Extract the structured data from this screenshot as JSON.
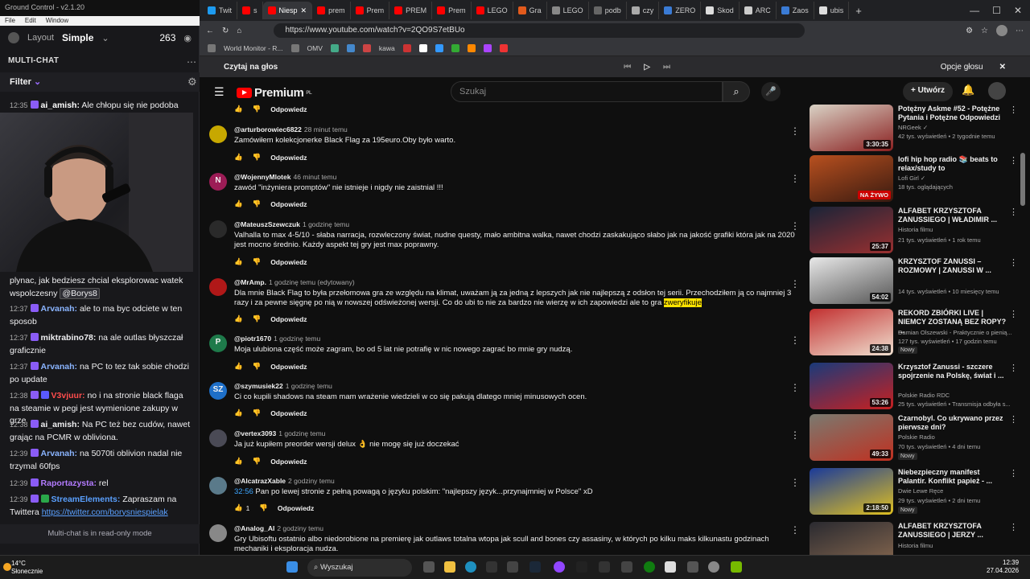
{
  "gc": {
    "title": "Ground Control - v2.1.20",
    "menu": [
      "File",
      "Edit",
      "Window"
    ],
    "layout_label": "Layout",
    "layout_value": "Simple",
    "viewers": "263",
    "panel_title": "MULTI-CHAT",
    "filter_label": "Filter",
    "readonly_text": "Multi-chat is in read-only mode",
    "messages": [
      {
        "time": "12:35",
        "user": "ai_amish:",
        "text": "Ale chłopu się nie podoba",
        "color": "#ffffff"
      },
      {
        "time": "",
        "user": "",
        "text": "plynac, jak bedziesz chcial eksplorowac watek wspolczesny",
        "mention": "@Borys8",
        "color": "#ffffff"
      },
      {
        "time": "12:37",
        "user": "Arvanah:",
        "text": "ale to ma byc odciete w ten sposob",
        "color": "#8ab4ff"
      },
      {
        "time": "12:37",
        "user": "miktrabino78:",
        "text": "na ale outlas błyszczał graficznie",
        "color": "#ffffff"
      },
      {
        "time": "12:37",
        "user": "Arvanah:",
        "text": "na PC to tez tak sobie chodzi po update",
        "color": "#8ab4ff"
      },
      {
        "time": "12:38",
        "user": "V3vjuur:",
        "text": "no i na stronie black flaga na steamie w pegi jest wymienione zakupy w grze",
        "color": "#ff4d4d"
      },
      {
        "time": "12:38",
        "user": "ai_amish:",
        "text": "Na PC też bez cudów, nawet grając na PCMR w obliviona.",
        "color": "#ffffff"
      },
      {
        "time": "12:39",
        "user": "Arvanah:",
        "text": "na 5070ti oblivion nadal nie trzymal 60fps",
        "color": "#8ab4ff"
      },
      {
        "time": "12:39",
        "user": "Raportazysta:",
        "text": "rel",
        "color": "#b37bff"
      },
      {
        "time": "12:39",
        "user": "StreamElements:",
        "text": "Zapraszam na Twittera",
        "link": "https://twitter.com/borysniespielak",
        "color": "#5aa0ff"
      }
    ]
  },
  "browser": {
    "tabs": [
      "Twit",
      "s",
      "Niesp",
      "prem",
      "Prem",
      "PREM",
      "Prem",
      "LEGO",
      "Gra",
      "LEGO",
      "podb",
      "czy",
      "ZERO",
      "Skod",
      "ARC",
      "Zaos",
      "ubis"
    ],
    "active_tab": 2,
    "url": "https://www.youtube.com/watch?v=2QO9S7etBUo",
    "bookmarks": [
      "World Monitor - R...",
      "OMV",
      "kawa"
    ],
    "read_aloud": "Czytaj na głos",
    "voice_options": "Opcje głosu"
  },
  "yt": {
    "logo": "Premium",
    "logo_sup": "PL",
    "search_placeholder": "Szukaj",
    "create": "Utwórz",
    "reply": "Odpowiedz",
    "comments": [
      {
        "user": "@arturborowiec6822",
        "time": "28 minut temu",
        "text": "Zamówiłem kolekcjonerke Black Flag za 195euro.Oby było warto.",
        "av": "#c7a800",
        "letter": ""
      },
      {
        "user": "@WojennyMlotek",
        "time": "46 minut temu",
        "text": "zawód \"inżyniera promptów\" nie istnieje i nigdy nie zaistnial !!!",
        "av": "#9c1c56",
        "letter": "N"
      },
      {
        "user": "@MateuszSzewczuk",
        "time": "1 godzinę temu",
        "text": "Valhalla to max 4-5/10 - słaba narracja, rozwleczony świat, nudne questy, mało ambitna walka, nawet chodzi zaskakująco słabo jak na jakość grafiki która jak na 2020 jest mocno średnio. Każdy aspekt tej gry jest max poprawny.",
        "av": "#333",
        "letter": ""
      },
      {
        "user": "@MrAmp.",
        "time": "1 godzinę temu (edytowany)",
        "text": "Dla mnie Black Flag to była przełomowa gra ze względu na klimat, uważam ją za jedną z lepszych jak nie najlepszą z odsłon tej serii. Przechodziłem ją co najmniej 3 razy i za pewne sięgnę po nią w nowszej odświeżonej wersji. Co do ubi to nie za bardzo nie wierzę w ich zapowiedzi ale to gra ",
        "highlight": "zweryfikuje",
        "av": "#b01818",
        "letter": ""
      },
      {
        "user": "@piotr1670",
        "time": "1 godzinę temu",
        "text": "Moja ulubiona część może zagram, bo od 5 lat nie potrafię w nic nowego zagrać bo mnie gry nudzą.",
        "av": "#1e7a4a",
        "letter": "P"
      },
      {
        "user": "@szymusiek22",
        "time": "1 godzinę temu",
        "text": "Ci co kupili shadows na steam mam wrażenie wiedzieli w co się pakują dlatego mniej minusowych ocen.",
        "av": "#1e6fc8",
        "letter": "SZ"
      },
      {
        "user": "@vertex3093",
        "time": "1 godzinę temu",
        "text": "Ja już kupiłem preorder wersji delux 👌 nie mogę się już doczekać",
        "av": "#555",
        "letter": ""
      },
      {
        "user": "@AlcatrazXable",
        "time": "2 godziny temu",
        "ts": "32:56",
        "text": " Pan po lewej stronie z pełną powagą o języku polskim: \"najlepszy język...przynajmniej w Polsce\" xD",
        "likes": "1",
        "av": "#5a7a8a",
        "letter": ""
      },
      {
        "user": "@Analog_AI",
        "time": "2 godziny temu",
        "text": "Gry Ubisoftu  ostatnio albo niedorobione na premierę jak outlaws  totalna wtopa jak scull and bones czy assasiny, w których  po kilku maks kilkunastu godzinach mechaniki i eksploracja nudza.",
        "av": "#888",
        "letter": ""
      }
    ],
    "videos": [
      {
        "title": "Potężny Askme #52 - Potężne Pytania i Potężne Odpowiedzi",
        "channel": "NRGeek ✓",
        "meta": "42 tys. wyświetleń • 2 tygodnie temu",
        "dur": "3:30:35",
        "c1": "#d9d2c5",
        "c2": "#8a2020"
      },
      {
        "title": "lofi hip hop radio 📚 beats to relax/study to",
        "channel": "Lofi Girl ✓",
        "meta": "18 tys. oglądających",
        "live": "NA ŻYWO",
        "c1": "#b8501f",
        "c2": "#3a1a10"
      },
      {
        "title": "ALFABET KRZYSZTOFA ZANUSSIEGO | WŁADIMIR ...",
        "channel": "Historia filmu",
        "meta": "21 tys. wyświetleń • 1 rok temu",
        "dur": "25:37",
        "c1": "#1a2438",
        "c2": "#9a3030"
      },
      {
        "title": "KRZYSZTOF ZANUSSI – ROZMOWY | ZANUSSI W ...",
        "channel": "",
        "meta": "14 tys. wyświetleń • 10 miesięcy temu",
        "dur": "54:02",
        "c1": "#e8e8e8",
        "c2": "#555"
      },
      {
        "title": "REKORD ZBIÓRKI LIVE | NIEMCY ZOSTANĄ BEZ ROPY? ...",
        "channel": "Damian Olszewski - Praktycznie o pienią...",
        "meta": "127 tys. wyświetleń • 17 godzin temu",
        "new": "Nowy",
        "dur": "24:38",
        "c1": "#c23030",
        "c2": "#f0e0d0"
      },
      {
        "title": "Krzysztof Zanussi - szczere spojrzenie na Polskę, świat i ...",
        "channel": "Polskie Radio RDC",
        "meta": "25 tys. wyświetleń • Transmisja odbyła s...",
        "dur": "53:26",
        "c1": "#1a3a7a",
        "c2": "#c82020"
      },
      {
        "title": "Czarnobyl. Co ukrywano przez pierwsze dni?",
        "channel": "Polskie Radio",
        "meta": "70 tys. wyświetleń • 4 dni temu",
        "new": "Nowy",
        "dur": "49:33",
        "c1": "#7a7a70",
        "c2": "#c03020"
      },
      {
        "title": "Niebezpieczny manifest Palantir. Konflikt papież - ...",
        "channel": "Dwie Lewe Ręce",
        "meta": "29 tys. wyświetleń • 2 dni temu",
        "new": "Nowy",
        "dur": "2:18:50",
        "c1": "#1a3a9a",
        "c2": "#e0c020"
      },
      {
        "title": "ALFABET KRZYSZTOFA ZANUSSIEGO | JERZY ...",
        "channel": "Historia filmu",
        "meta": "",
        "dur": "",
        "c1": "#2a2a30",
        "c2": "#8a6a50"
      }
    ]
  },
  "taskbar": {
    "temp": "14°C",
    "weather": "Słonecznie",
    "search": "Wyszukaj",
    "time": "12:39",
    "date": "27.04.2026"
  }
}
